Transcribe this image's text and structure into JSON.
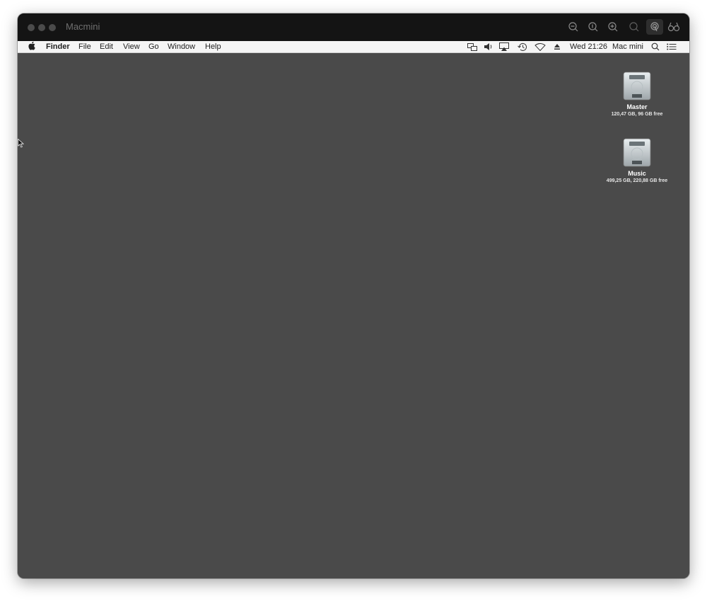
{
  "window": {
    "title": "Macmini"
  },
  "toolbar_icons": [
    {
      "name": "zoom-out-icon"
    },
    {
      "name": "zoom-actual-icon"
    },
    {
      "name": "zoom-in-icon"
    },
    {
      "name": "zoom-fit-icon"
    },
    {
      "name": "touch-pointer-icon"
    },
    {
      "name": "binoculars-icon"
    }
  ],
  "menubar": {
    "apple_icon": "apple-icon",
    "items": [
      "Finder",
      "File",
      "Edit",
      "View",
      "Go",
      "Window",
      "Help"
    ],
    "status_icons": [
      "screen-mirroring-icon",
      "volume-icon",
      "airplay-icon",
      "time-machine-icon",
      "wifi-icon",
      "eject-icon"
    ],
    "clock": "Wed 21:26",
    "user": "Mac mini",
    "spotlight_icon": "search-icon",
    "notification_icon": "list-icon"
  },
  "desktop": {
    "disks": [
      {
        "name": "Master",
        "info": "120,47 GB, 96 GB free"
      },
      {
        "name": "Music",
        "info": "499,25 GB, 220,88 GB free"
      }
    ]
  },
  "colors": {
    "desktop": "#4a4a4a",
    "titlebar": "#141414",
    "menubar": "#f5f5f5"
  }
}
